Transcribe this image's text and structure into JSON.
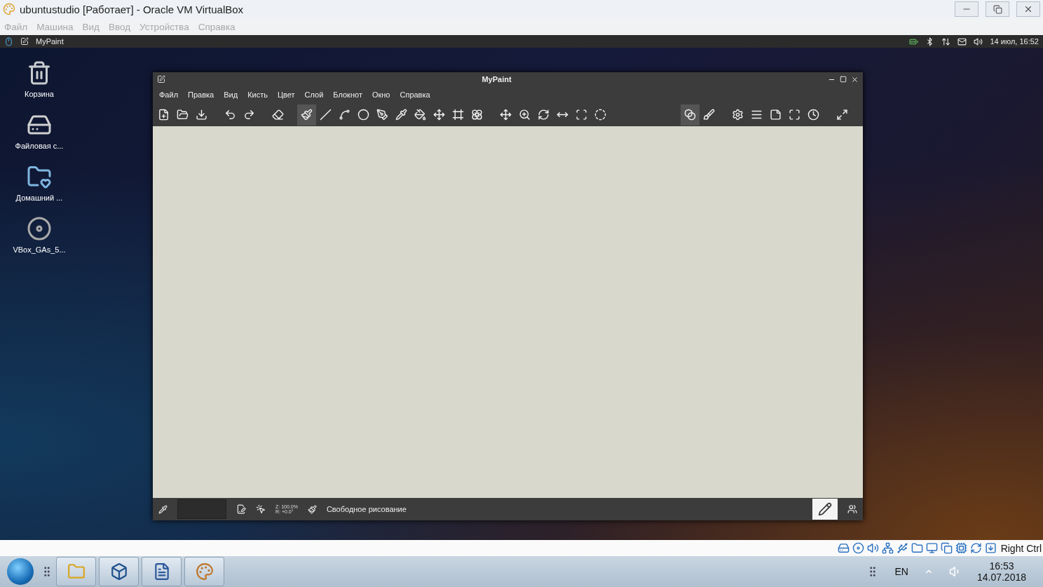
{
  "host_window": {
    "title": "ubuntustudio [Работает] - Oracle VM VirtualBox",
    "menu": [
      "Файл",
      "Машина",
      "Вид",
      "Ввод",
      "Устройства",
      "Справка"
    ]
  },
  "guest_panel": {
    "tasks": [
      {
        "label": "MyPaint"
      }
    ],
    "tray": [
      {
        "kind": "battery"
      },
      {
        "kind": "bluetooth"
      },
      {
        "kind": "network"
      },
      {
        "kind": "mail"
      },
      {
        "kind": "volume"
      }
    ],
    "clock": "14 июл, 16:52"
  },
  "desktop_icons": [
    {
      "label": "Корзина",
      "kind": "trash"
    },
    {
      "label": "Файловая с...",
      "kind": "drive"
    },
    {
      "label": "Домашний ...",
      "kind": "home"
    },
    {
      "label": "VBox_GAs_5...",
      "kind": "disc"
    }
  ],
  "app_window": {
    "title": "MyPaint",
    "menu": [
      "Файл",
      "Правка",
      "Вид",
      "Кисть",
      "Цвет",
      "Слой",
      "Блокнот",
      "Окно",
      "Справка"
    ],
    "left_groups": [
      [
        {
          "kind": "new",
          "selected": false
        },
        {
          "kind": "open",
          "selected": false
        },
        {
          "kind": "save",
          "selected": false
        }
      ],
      [
        {
          "kind": "undo",
          "selected": false
        },
        {
          "kind": "redo",
          "selected": false
        }
      ],
      [
        {
          "kind": "eraser",
          "selected": false
        }
      ],
      [
        {
          "kind": "brush",
          "selected": true
        },
        {
          "kind": "line",
          "selected": false
        },
        {
          "kind": "curve",
          "selected": false
        },
        {
          "kind": "ellipse",
          "selected": false
        },
        {
          "kind": "pen",
          "selected": false
        },
        {
          "kind": "picker",
          "selected": false
        },
        {
          "kind": "fill",
          "selected": false
        },
        {
          "kind": "move",
          "selected": false
        },
        {
          "kind": "frame",
          "selected": false
        },
        {
          "kind": "symmetry",
          "selected": false
        }
      ],
      [
        {
          "kind": "pan",
          "selected": false
        },
        {
          "kind": "zoom",
          "selected": false
        },
        {
          "kind": "rotate",
          "selected": false
        },
        {
          "kind": "flip",
          "selected": false
        },
        {
          "kind": "reset",
          "selected": false
        },
        {
          "kind": "fit",
          "selected": false
        }
      ]
    ],
    "right_groups": [
      [
        {
          "kind": "colors",
          "selected": true
        },
        {
          "kind": "brushes",
          "selected": false
        }
      ],
      [
        {
          "kind": "settings",
          "selected": false
        },
        {
          "kind": "layers",
          "selected": false
        },
        {
          "kind": "scratchpad",
          "selected": false
        },
        {
          "kind": "fullscreen",
          "selected": false
        },
        {
          "kind": "history",
          "selected": false
        }
      ],
      [
        {
          "kind": "expand",
          "selected": false
        }
      ]
    ],
    "status": {
      "zoom": "Z: 100.0%",
      "rotation": "R: +0.0°",
      "mode": "Свободное рисование"
    }
  },
  "vbox_status": {
    "icons": [
      {
        "kind": "hdd"
      },
      {
        "kind": "optical"
      },
      {
        "kind": "audio"
      },
      {
        "kind": "network"
      },
      {
        "kind": "usb"
      },
      {
        "kind": "shared"
      },
      {
        "kind": "display"
      },
      {
        "kind": "capture"
      },
      {
        "kind": "cpu"
      },
      {
        "kind": "mouse"
      },
      {
        "kind": "keyboard"
      }
    ],
    "host_key": "Right Ctrl"
  },
  "taskbar": {
    "apps": [
      {
        "kind": "explorer"
      },
      {
        "kind": "virtualbox"
      },
      {
        "kind": "word"
      },
      {
        "kind": "paint"
      }
    ],
    "language": "EN",
    "time": "16:53",
    "date": "14.07.2018"
  }
}
